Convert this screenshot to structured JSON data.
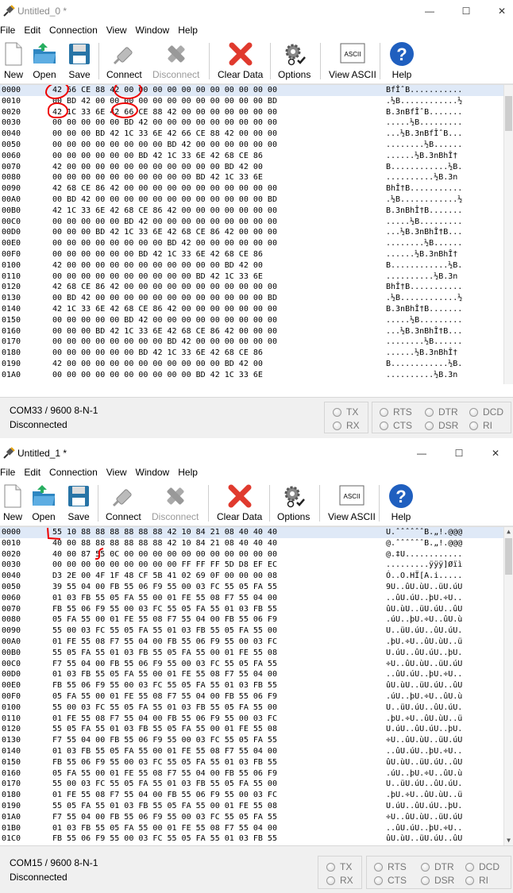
{
  "windows": [
    {
      "title": "Untitled_0 *",
      "menu": [
        "File",
        "Edit",
        "Connection",
        "View",
        "Window",
        "Help"
      ],
      "toolbar": {
        "new": "New",
        "open": "Open",
        "save": "Save",
        "connect": "Connect",
        "disconnect": "Disconnect",
        "clear": "Clear Data",
        "options": "Options",
        "view_ascii": "View ASCII",
        "help": "Help",
        "ascii_icon_text": "ASCII"
      },
      "rows": [
        [
          "0000",
          "42 66 CE 88 42 00 00 00 00 00 00 00 00 00 00 00",
          "BfÎˆB..........."
        ],
        [
          "0010",
          "00 BD 42 00 00 00 00 00 00 00 00 00 00 00 00 BD",
          ".½B............½"
        ],
        [
          "0020",
          "42 1C 33 6E 42 66 CE 88 42 00 00 00 00 00 00 00",
          "B.3nBfÎˆB......."
        ],
        [
          "0030",
          "00 00 00 00 00 BD 42 00 00 00 00 00 00 00 00 00",
          ".....½B........."
        ],
        [
          "0040",
          "00 00 00 BD 42 1C 33 6E 42 66 CE 88 42 00 00 00",
          "...½B.3nBfÎˆB..."
        ],
        [
          "0050",
          "00 00 00 00 00 00 00 00 BD 42 00 00 00 00 00 00",
          "........½B......"
        ],
        [
          "0060",
          "00 00 00 00 00 00 BD 42 1C 33 6E 42 68 CE 86",
          "......½B.3nBhÎ†"
        ],
        [
          "0070",
          "42 00 00 00 00 00 00 00 00 00 00 00 BD 42 00",
          "B............½B."
        ],
        [
          "0080",
          "00 00 00 00 00 00 00 00 00 00 BD 42 1C 33 6E",
          "..........½B.3n"
        ],
        [
          "0090",
          "42 68 CE 86 42 00 00 00 00 00 00 00 00 00 00 00",
          "BhÎ†B..........."
        ],
        [
          "00A0",
          "00 BD 42 00 00 00 00 00 00 00 00 00 00 00 00 BD",
          ".½B............½"
        ],
        [
          "00B0",
          "42 1C 33 6E 42 68 CE 86 42 00 00 00 00 00 00 00",
          "B.3nBhÎ†B......."
        ],
        [
          "00C0",
          "00 00 00 00 00 BD 42 00 00 00 00 00 00 00 00 00",
          ".....½B........."
        ],
        [
          "00D0",
          "00 00 00 BD 42 1C 33 6E 42 68 CE 86 42 00 00 00",
          "...½B.3nBhÎ†B..."
        ],
        [
          "00E0",
          "00 00 00 00 00 00 00 00 BD 42 00 00 00 00 00 00",
          "........½B......"
        ],
        [
          "00F0",
          "00 00 00 00 00 00 BD 42 1C 33 6E 42 68 CE 86",
          "......½B.3nBhÎ†"
        ],
        [
          "0100",
          "42 00 00 00 00 00 00 00 00 00 00 00 BD 42 00",
          "B............½B."
        ],
        [
          "0110",
          "00 00 00 00 00 00 00 00 00 00 BD 42 1C 33 6E",
          "..........½B.3n"
        ],
        [
          "0120",
          "42 68 CE 86 42 00 00 00 00 00 00 00 00 00 00 00",
          "BhÎ†B..........."
        ],
        [
          "0130",
          "00 BD 42 00 00 00 00 00 00 00 00 00 00 00 00 BD",
          ".½B............½"
        ],
        [
          "0140",
          "42 1C 33 6E 42 68 CE 86 42 00 00 00 00 00 00 00",
          "B.3nBhÎ†B......."
        ],
        [
          "0150",
          "00 00 00 00 00 BD 42 00 00 00 00 00 00 00 00 00",
          ".....½B........."
        ],
        [
          "0160",
          "00 00 00 BD 42 1C 33 6E 42 68 CE 86 42 00 00 00",
          "...½B.3nBhÎ†B..."
        ],
        [
          "0170",
          "00 00 00 00 00 00 00 00 BD 42 00 00 00 00 00 00",
          "........½B......"
        ],
        [
          "0180",
          "00 00 00 00 00 00 BD 42 1C 33 6E 42 68 CE 86",
          "......½B.3nBhÎ†"
        ],
        [
          "0190",
          "42 00 00 00 00 00 00 00 00 00 00 00 BD 42 00",
          "B............½B."
        ],
        [
          "01A0",
          "00 00 00 00 00 00 00 00 00 00 BD 42 1C 33 6E",
          "..........½B.3n"
        ]
      ],
      "status": {
        "port": "COM33 / 9600 8-N-1",
        "state": "Disconnected"
      },
      "leds": {
        "tx": "TX",
        "rx": "RX",
        "rts": "RTS",
        "cts": "CTS",
        "dtr": "DTR",
        "dsr": "DSR",
        "dcd": "DCD",
        "ri": "RI"
      }
    },
    {
      "title": "Untitled_1 *",
      "menu": [
        "File",
        "Edit",
        "Connection",
        "View",
        "Window",
        "Help"
      ],
      "toolbar": {
        "new": "New",
        "open": "Open",
        "save": "Save",
        "connect": "Connect",
        "disconnect": "Disconnect",
        "clear": "Clear Data",
        "options": "Options",
        "view_ascii": "View ASCII",
        "help": "Help",
        "ascii_icon_text": "ASCII"
      },
      "rows": [
        [
          "0000",
          "55 10 88 88 88 88 88 88 42 10 84 21 08 40 40 40",
          "U.ˆˆˆˆˆˆB.„!.@@@"
        ],
        [
          "0010",
          "40 00 88 88 88 88 88 88 42 10 84 21 08 40 40 40",
          "@.ˆˆˆˆˆˆB.„!.@@@"
        ],
        [
          "0020",
          "40 00 87 55 0C 00 00 00 00 00 00 00 00 00 00 00",
          "@.‡U............"
        ],
        [
          "0030",
          "00 00 00 00 00 00 00 00 00 FF FF FF 5D D8 EF EC",
          ".........ÿÿÿ]Øïì"
        ],
        [
          "0040",
          "D3 2E 00 4F 1F 48 CF 5B 41 02 69 0F 00 00 00 08",
          "Ó..O.HÏ[A.i....."
        ],
        [
          "0050",
          "39 55 04 00 FB 55 06 F9 55 00 03 FC 55 05 FA 55",
          "9U..ûU.ùU..üU.úU"
        ],
        [
          "0060",
          "01 03 FB 55 05 FA 55 00 01 FE 55 08 F7 55 04 00",
          "..ûU.úU..þU.÷U.."
        ],
        [
          "0070",
          "FB 55 06 F9 55 00 03 FC 55 05 FA 55 01 03 FB 55",
          "ûU.ùU..üU.úU..ûU"
        ],
        [
          "0080",
          "05 FA 55 00 01 FE 55 08 F7 55 04 00 FB 55 06 F9",
          ".úU..þU.÷U..ûU.ù"
        ],
        [
          "0090",
          "55 00 03 FC 55 05 FA 55 01 03 FB 55 05 FA 55 00",
          "U..üU.úU..ûU.úU."
        ],
        [
          "00A0",
          "01 FE 55 08 F7 55 04 00 FB 55 06 F9 55 00 03 FC",
          ".þU.÷U..ûU.ùU..ü"
        ],
        [
          "00B0",
          "55 05 FA 55 01 03 FB 55 05 FA 55 00 01 FE 55 08",
          "U.úU..ûU.úU..þU."
        ],
        [
          "00C0",
          "F7 55 04 00 FB 55 06 F9 55 00 03 FC 55 05 FA 55",
          "÷U..ûU.ùU..üU.úU"
        ],
        [
          "00D0",
          "01 03 FB 55 05 FA 55 00 01 FE 55 08 F7 55 04 00",
          "..ûU.úU..þU.÷U.."
        ],
        [
          "00E0",
          "FB 55 06 F9 55 00 03 FC 55 05 FA 55 01 03 FB 55",
          "ûU.ùU..üU.úU..ûU"
        ],
        [
          "00F0",
          "05 FA 55 00 01 FE 55 08 F7 55 04 00 FB 55 06 F9",
          ".úU..þU.÷U..ûU.ù"
        ],
        [
          "0100",
          "55 00 03 FC 55 05 FA 55 01 03 FB 55 05 FA 55 00",
          "U..üU.úU..ûU.úU."
        ],
        [
          "0110",
          "01 FE 55 08 F7 55 04 00 FB 55 06 F9 55 00 03 FC",
          ".þU.÷U..ûU.ùU..ü"
        ],
        [
          "0120",
          "55 05 FA 55 01 03 FB 55 05 FA 55 00 01 FE 55 08",
          "U.úU..ûU.úU..þU."
        ],
        [
          "0130",
          "F7 55 04 00 FB 55 06 F9 55 00 03 FC 55 05 FA 55",
          "÷U..ûU.ùU..üU.úU"
        ],
        [
          "0140",
          "01 03 FB 55 05 FA 55 00 01 FE 55 08 F7 55 04 00",
          "..ûU.úU..þU.÷U.."
        ],
        [
          "0150",
          "FB 55 06 F9 55 00 03 FC 55 05 FA 55 01 03 FB 55",
          "ûU.ùU..üU.úU..ûU"
        ],
        [
          "0160",
          "05 FA 55 00 01 FE 55 08 F7 55 04 00 FB 55 06 F9",
          ".úU..þU.÷U..ûU.ù"
        ],
        [
          "0170",
          "55 00 03 FC 55 05 FA 55 01 03 FB 55 05 FA 55 00",
          "U..üU.úU..ûU.úU."
        ],
        [
          "0180",
          "01 FE 55 08 F7 55 04 00 FB 55 06 F9 55 00 03 FC",
          ".þU.÷U..ûU.ùU..ü"
        ],
        [
          "0190",
          "55 05 FA 55 01 03 FB 55 05 FA 55 00 01 FE 55 08",
          "U.úU..ûU.úU..þU."
        ],
        [
          "01A0",
          "F7 55 04 00 FB 55 06 F9 55 00 03 FC 55 05 FA 55",
          "÷U..ûU.ùU..üU.úU"
        ],
        [
          "01B0",
          "01 03 FB 55 05 FA 55 00 01 FE 55 08 F7 55 04 00",
          "..ûU.úU..þU.÷U.."
        ],
        [
          "01C0",
          "FB 55 06 F9 55 00 03 FC 55 05 FA 55 01 03 FB 55",
          "ûU.ùU..üU.úU..ûU"
        ]
      ],
      "status": {
        "port": "COM15 / 9600 8-N-1",
        "state": "Disconnected"
      },
      "leds": {
        "tx": "TX",
        "rx": "RX",
        "rts": "RTS",
        "cts": "CTS",
        "dtr": "DTR",
        "dsr": "DSR",
        "dcd": "DCD",
        "ri": "RI"
      }
    }
  ],
  "colors": {
    "annotation": "#e00000",
    "selection": "#dfe9f7"
  }
}
